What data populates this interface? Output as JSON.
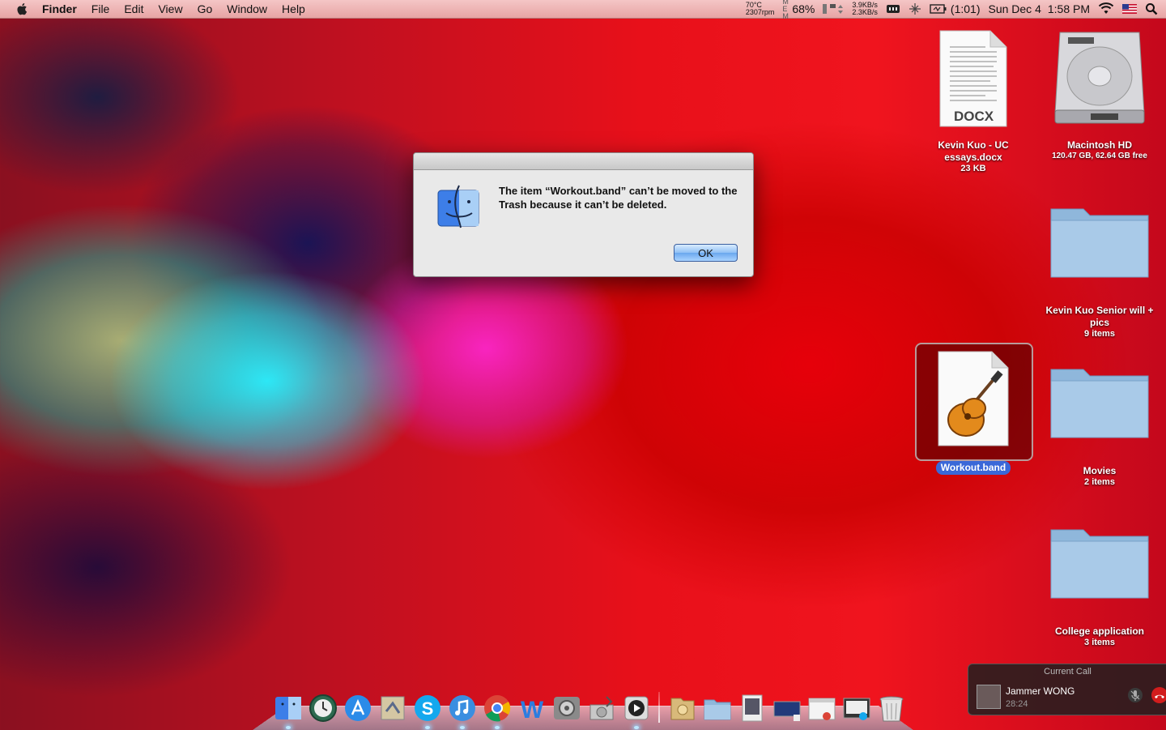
{
  "menubar": {
    "app_name": "Finder",
    "menus": [
      "File",
      "Edit",
      "View",
      "Go",
      "Window",
      "Help"
    ],
    "status": {
      "temperature": "70°C",
      "fan": "2307rpm",
      "mem_label": "M E M",
      "cpu_percent": "68%",
      "net_up": "3.9KB/s",
      "net_down": "2.3KB/s",
      "battery_time": "(1:01)",
      "date": "Sun Dec 4",
      "time": "1:58 PM"
    }
  },
  "desktop": {
    "icons": [
      {
        "label": "Kevin Kuo - UC essays.docx",
        "sub": "23 KB",
        "badge": "DOCX"
      },
      {
        "label": "Macintosh HD",
        "sub": "120.47 GB, 62.64 GB free"
      },
      {
        "label": "Kevin Kuo Senior will + pics",
        "sub": "9 items"
      },
      {
        "label": "Workout.band",
        "sub": ""
      },
      {
        "label": "Movies",
        "sub": "2 items"
      },
      {
        "label": "College application",
        "sub": "3 items"
      }
    ]
  },
  "alert": {
    "message": "The item “Workout.band” can’t be moved to the Trash because it can’t be deleted.",
    "ok_label": "OK"
  },
  "dock": {
    "items": [
      "finder-icon",
      "time-machine-icon",
      "app-store-icon",
      "preview-icon",
      "skype-icon",
      "itunes-icon",
      "chrome-icon",
      "word-icon",
      "system-preferences-icon",
      "disk-utility-icon",
      "quicktime-icon",
      "documents-stack-icon",
      "folder-stack-icon",
      "photos-stack-icon",
      "screenshot-stack-icon",
      "browser-stack-icon",
      "window-stack-icon",
      "trash-icon"
    ]
  },
  "call": {
    "header": "Current Call",
    "name": "Jammer WONG",
    "duration": "28:24"
  }
}
